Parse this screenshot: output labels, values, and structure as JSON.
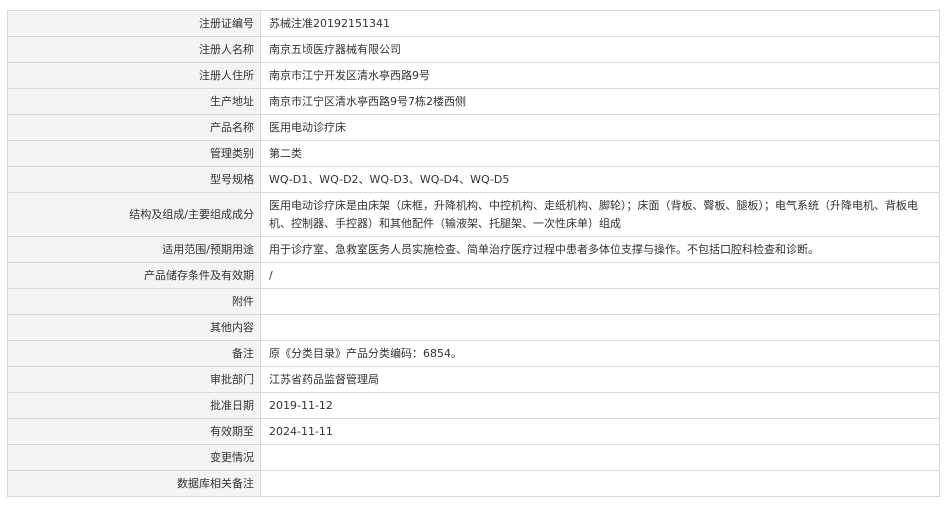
{
  "rows": [
    {
      "key": "reg_no",
      "label": "注册证编号",
      "value": "苏械注准20192151341"
    },
    {
      "key": "registrant",
      "label": "注册人名称",
      "value": "南京五顷医疗器械有限公司"
    },
    {
      "key": "registrant_address",
      "label": "注册人住所",
      "value": "南京市江宁开发区清水亭西路9号"
    },
    {
      "key": "production_address",
      "label": "生产地址",
      "value": "南京市江宁区清水亭西路9号7栋2楼西侧"
    },
    {
      "key": "product_name",
      "label": "产品名称",
      "value": "医用电动诊疗床"
    },
    {
      "key": "category",
      "label": "管理类别",
      "value": "第二类"
    },
    {
      "key": "model",
      "label": "型号规格",
      "value": "WQ-D1、WQ-D2、WQ-D3、WQ-D4、WQ-D5"
    },
    {
      "key": "structure",
      "label": "结构及组成/主要组成成分",
      "value": "医用电动诊疗床是由床架（床框，升降机构、中控机构、走纸机构、脚轮）；床面（背板、臀板、腿板）；电气系统（升降电机、背板电机、控制器、手控器）和其他配件（输液架、托腿架、一次性床单）组成"
    },
    {
      "key": "scope",
      "label": "适用范围/预期用途",
      "value": "用于诊疗室、急救室医务人员实施检查、简单治疗医疗过程中患者多体位支撑与操作。不包括口腔科检查和诊断。"
    },
    {
      "key": "storage",
      "label": "产品储存条件及有效期",
      "value": "/"
    },
    {
      "key": "attachment",
      "label": "附件",
      "value": ""
    },
    {
      "key": "other",
      "label": "其他内容",
      "value": ""
    },
    {
      "key": "remark",
      "label": "备注",
      "value": "原《分类目录》产品分类编码：6854。"
    },
    {
      "key": "approval_dept",
      "label": "审批部门",
      "value": "江苏省药品监督管理局"
    },
    {
      "key": "approval_date",
      "label": "批准日期",
      "value": "2019-11-12"
    },
    {
      "key": "valid_until",
      "label": "有效期至",
      "value": "2024-11-11"
    },
    {
      "key": "changes",
      "label": "变更情况",
      "value": ""
    },
    {
      "key": "db_remark",
      "label": "数据库相关备注",
      "value": ""
    }
  ]
}
